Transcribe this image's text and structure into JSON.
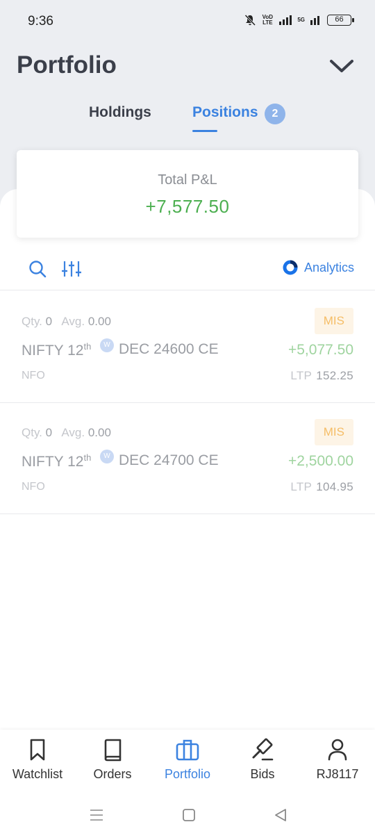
{
  "status_bar": {
    "time": "9:36",
    "network_label": "VoD LTE",
    "network_5g": "5G",
    "battery": "66"
  },
  "header": {
    "title": "Portfolio"
  },
  "tabs": [
    {
      "label": "Holdings",
      "active": false
    },
    {
      "label": "Positions",
      "active": true,
      "badge": "2"
    }
  ],
  "summary": {
    "label": "Total P&L",
    "value": "+7,577.50"
  },
  "toolbar": {
    "analytics_label": "Analytics"
  },
  "labels": {
    "qty": "Qty.",
    "avg": "Avg.",
    "ltp": "LTP"
  },
  "positions": [
    {
      "qty": "0",
      "avg": "0.00",
      "product": "MIS",
      "symbol_prefix": "NIFTY 12",
      "symbol_sup": "th",
      "weekly_badge": "W",
      "symbol_suffix": "DEC 24600 CE",
      "pnl": "+5,077.50",
      "exchange": "NFO",
      "ltp": "152.25"
    },
    {
      "qty": "0",
      "avg": "0.00",
      "product": "MIS",
      "symbol_prefix": "NIFTY 12",
      "symbol_sup": "th",
      "weekly_badge": "W",
      "symbol_suffix": "DEC 24700 CE",
      "pnl": "+2,500.00",
      "exchange": "NFO",
      "ltp": "104.95"
    }
  ],
  "bottom_nav": [
    {
      "label": "Watchlist",
      "icon": "bookmark-icon"
    },
    {
      "label": "Orders",
      "icon": "book-icon"
    },
    {
      "label": "Portfolio",
      "icon": "briefcase-icon",
      "active": true
    },
    {
      "label": "Bids",
      "icon": "gavel-icon"
    },
    {
      "label": "RJ8117",
      "icon": "user-icon"
    }
  ],
  "colors": {
    "accent": "#3b82e0",
    "profit": "#4caf50",
    "badge_bg": "#fdf4e6",
    "badge_text": "#f5bd66"
  }
}
